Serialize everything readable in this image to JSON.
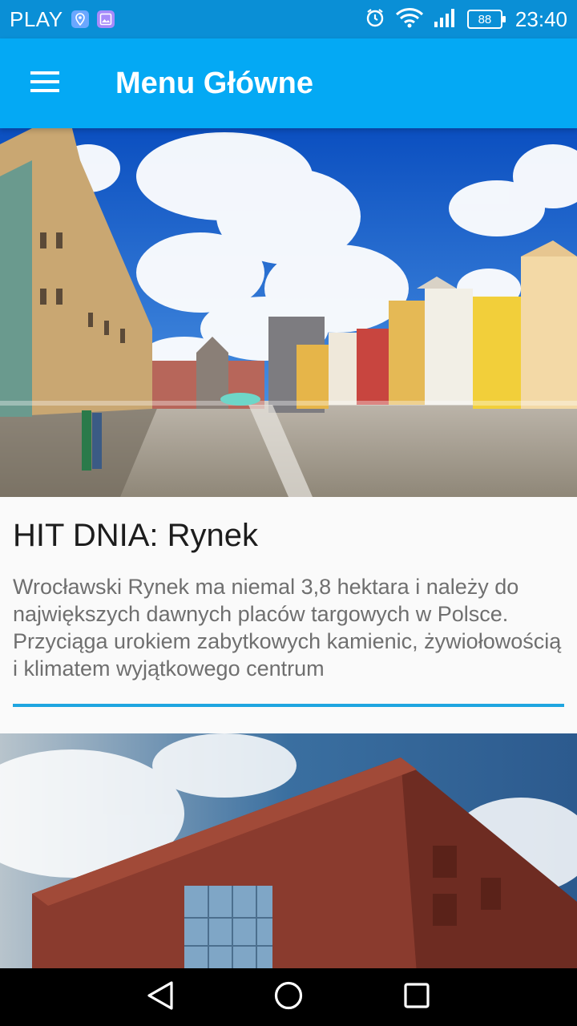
{
  "status_bar": {
    "carrier": "PLAY",
    "battery": "88",
    "time": "23:40",
    "icons": [
      "maps-icon",
      "gallery-icon",
      "alarm-icon",
      "wifi-icon",
      "signal-icon",
      "battery-icon"
    ]
  },
  "app_bar": {
    "title": "Menu Główne",
    "background_color": "#04a9f4",
    "menu_icon": "hamburger-menu-icon"
  },
  "cards": [
    {
      "title": "HIT DNIA: Rynek",
      "description": "Wrocławski Rynek ma niemal 3,8 hektara i należy do największych dawnych placów targowych w Polsce. Przyciąga urokiem zabytkowych kamienic, żywiołowością i klimatem wyjątkowego centrum",
      "accent_color": "#1fa5e0"
    }
  ],
  "nav_bar": {
    "icons": [
      "back-icon",
      "home-icon",
      "recents-icon"
    ]
  }
}
